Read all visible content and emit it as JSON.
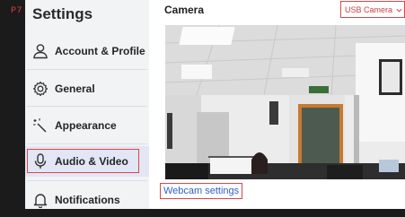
{
  "corner_tag": "P7",
  "sidebar": {
    "title": "Settings",
    "items": [
      {
        "label": "Account & Profile",
        "icon": "person-icon"
      },
      {
        "label": "General",
        "icon": "gear-icon"
      },
      {
        "label": "Appearance",
        "icon": "magic-wand-icon"
      },
      {
        "label": "Audio & Video",
        "icon": "microphone-icon",
        "active": true
      },
      {
        "label": "Notifications",
        "icon": "bell-icon"
      }
    ]
  },
  "main": {
    "camera_label": "Camera",
    "camera_select": "USB Camera",
    "webcam_settings_link": "Webcam settings"
  },
  "colors": {
    "highlight": "#d84848",
    "active_bg": "#e2e6f5",
    "link": "#2f5fc9",
    "sidebar_bg": "#f2f3f5"
  }
}
